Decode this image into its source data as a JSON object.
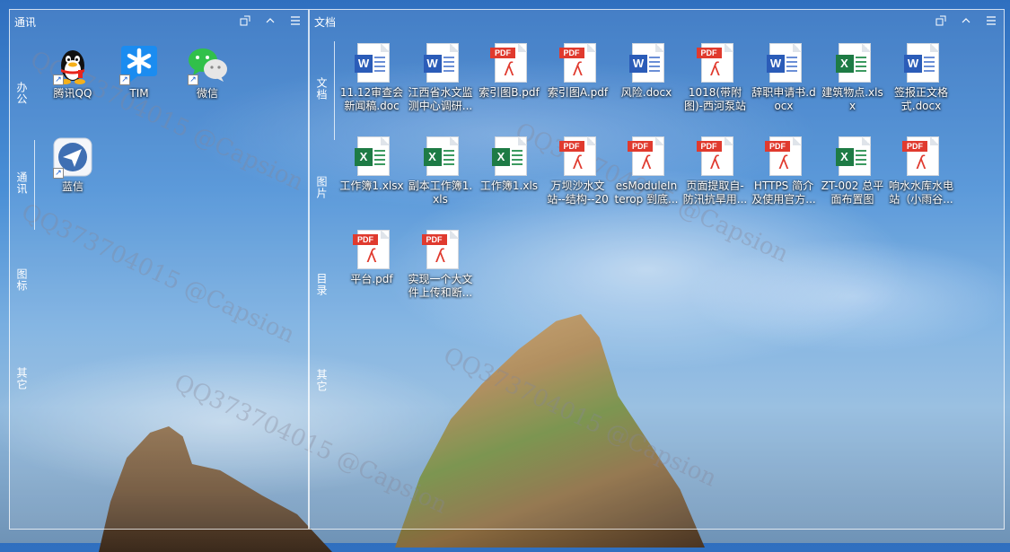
{
  "left_panel": {
    "title": "通讯",
    "tabs": [
      "办公",
      "通讯",
      "图标",
      "其它"
    ],
    "apps": [
      {
        "name": "腾讯QQ",
        "icon": "qq-icon"
      },
      {
        "name": "TIM",
        "icon": "tim-icon"
      },
      {
        "name": "微信",
        "icon": "wechat-icon"
      },
      {
        "name": "蓝信",
        "icon": "lanxin-icon"
      }
    ]
  },
  "right_panel": {
    "title": "文档",
    "tabs": [
      "文档",
      "图片",
      "目录",
      "其它"
    ],
    "files": [
      {
        "name": "11.12审查会新闻稿.doc",
        "type": "word"
      },
      {
        "name": "江西省水文监测中心调研...",
        "type": "word"
      },
      {
        "name": "索引图B.pdf",
        "type": "pdf"
      },
      {
        "name": "索引图A.pdf",
        "type": "pdf"
      },
      {
        "name": "风险.docx",
        "type": "word"
      },
      {
        "name": "1018(带附图)-西河泵站工...",
        "type": "pdf"
      },
      {
        "name": "辞职申请书.docx",
        "type": "word"
      },
      {
        "name": "建筑物点.xlsx",
        "type": "excel"
      },
      {
        "name": "签报正文格式.docx",
        "type": "word"
      },
      {
        "name": "工作簿1.xlsx",
        "type": "excel"
      },
      {
        "name": "副本工作簿1.xls",
        "type": "excel"
      },
      {
        "name": "工作簿1.xls",
        "type": "excel"
      },
      {
        "name": "万坝沙水文站--结构--202...",
        "type": "pdf"
      },
      {
        "name": "esModuleInterop 到底...",
        "type": "pdf"
      },
      {
        "name": "页面提取自-防汛抗旱用...",
        "type": "pdf"
      },
      {
        "name": "HTTPS 简介及使用官方...",
        "type": "pdf"
      },
      {
        "name": "ZT-002 总平面布置图(华...",
        "type": "excel"
      },
      {
        "name": "响水水库水电站（小雨谷...",
        "type": "pdf"
      },
      {
        "name": "平台.pdf",
        "type": "pdf"
      },
      {
        "name": "实现一个大文件上传和断...",
        "type": "pdf"
      }
    ]
  },
  "watermark": "QQ373704015 @Capsion"
}
